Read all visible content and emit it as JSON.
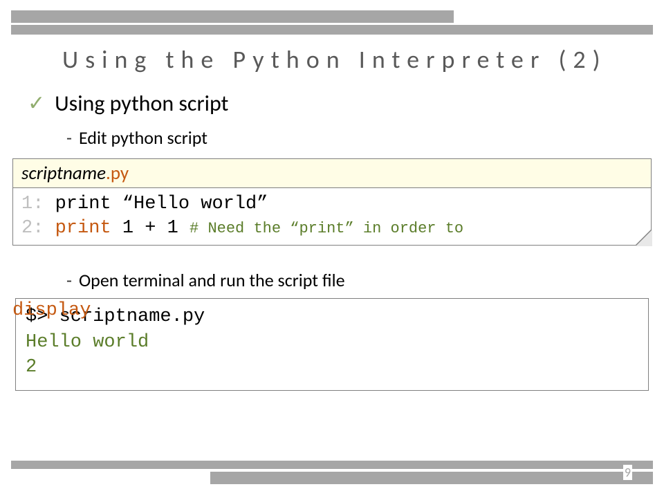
{
  "title": "Using the Python Interpreter (2)",
  "bullet_main": "Using python script",
  "sub1": "Edit python script",
  "file": {
    "name_base": "scriptname",
    "name_ext": ".py"
  },
  "code": {
    "l1_no": "1:",
    "l1_text": " print “Hello world”",
    "l2_no": "2:",
    "l2_kw": " print",
    "l2_rest": " 1 + 1  ",
    "l2_comment": "# Need the “print” in order to",
    "overflow": "display"
  },
  "sub2": "Open terminal and run the script file",
  "terminal": {
    "cmd": "$> scriptname.py",
    "out1": "Hello world",
    "out2": "2"
  },
  "page_number": "9"
}
